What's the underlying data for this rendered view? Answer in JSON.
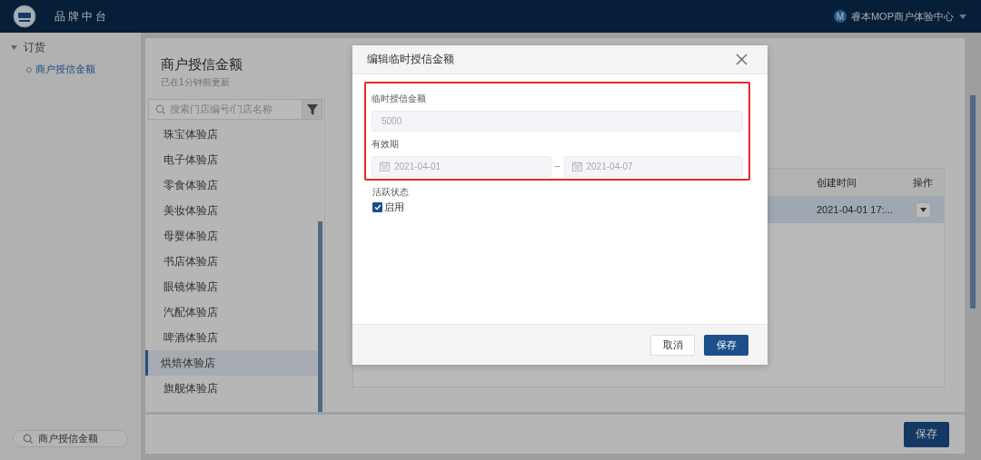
{
  "header": {
    "title": "品牌中台",
    "user": {
      "initial": "M",
      "name": "睿本MOP商户体验中心"
    }
  },
  "sidebar": {
    "items": [
      {
        "label": "订货",
        "expanded": true,
        "children": [
          {
            "label": "商户授信金额",
            "selected": true
          }
        ]
      }
    ],
    "search": {
      "value": "商户授信金额"
    }
  },
  "page": {
    "title": "商户授信金额",
    "subtitle": "已在1分钟前更新",
    "store_search": {
      "placeholder": "搜索门店编号/门店名称"
    },
    "stores": [
      {
        "label": "珠宝体验店",
        "selected": false
      },
      {
        "label": "电子体验店",
        "selected": false
      },
      {
        "label": "零食体验店",
        "selected": false
      },
      {
        "label": "美妆体验店",
        "selected": false
      },
      {
        "label": "母婴体验店",
        "selected": false
      },
      {
        "label": "书店体验店",
        "selected": false
      },
      {
        "label": "眼镜体验店",
        "selected": false
      },
      {
        "label": "汽配体验店",
        "selected": false
      },
      {
        "label": "啤酒体验店",
        "selected": false
      },
      {
        "label": "烘焙体验店",
        "selected": true
      },
      {
        "label": "旗舰体验店",
        "selected": false
      }
    ],
    "table": {
      "columns": [
        "创建时间",
        "操作"
      ],
      "rows": [
        {
          "created": "2021-04-01 17:...",
          "selected": true
        }
      ]
    },
    "save_button": "保存"
  },
  "dialog": {
    "title": "编辑临时授信金额",
    "amount": {
      "label": "临时授信金额",
      "value": "5000",
      "disabled": true
    },
    "validity": {
      "label": "有效期",
      "start": "2021-04-01",
      "separator": "–",
      "end": "2021-04-07"
    },
    "status": {
      "label": "活跃状态",
      "checkbox_label": "启用",
      "checked": true
    },
    "buttons": [
      {
        "label": "取消",
        "kind": "secondary"
      },
      {
        "label": "保存",
        "kind": "primary"
      }
    ]
  }
}
